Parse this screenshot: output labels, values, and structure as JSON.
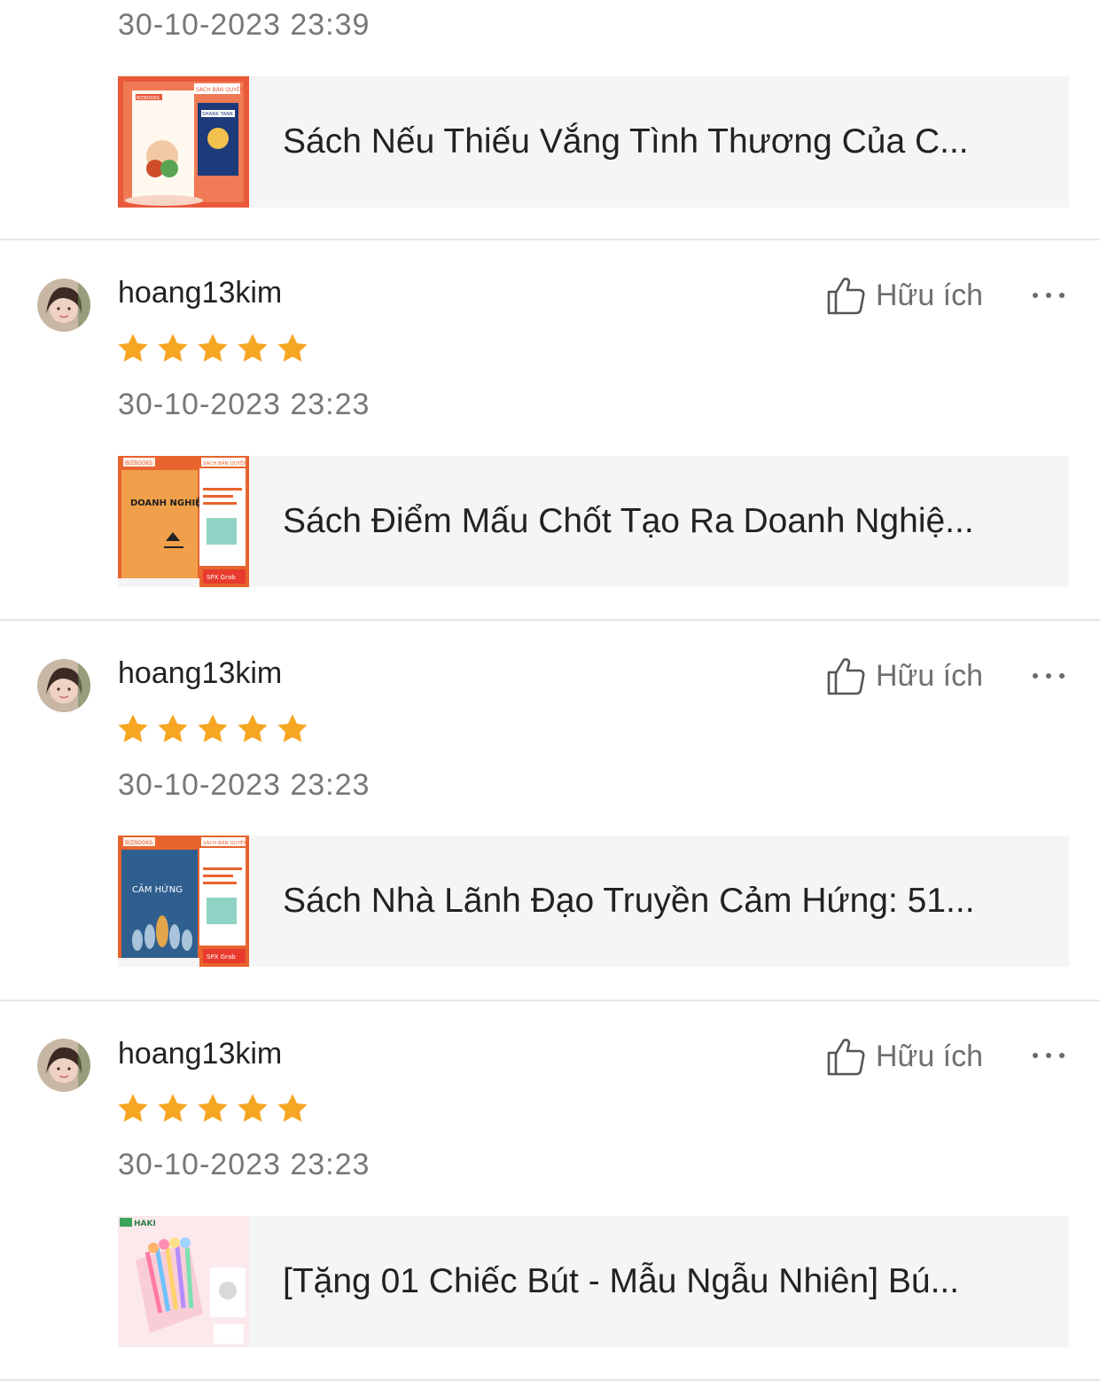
{
  "top_review": {
    "timestamp": "30-10-2023 23:39",
    "product": {
      "title": "Sách Nếu Thiếu Vắng Tình Thương Của C...",
      "thumb_badge": "BIZBOOKS",
      "thumb_tag": "SÁCH BẢN QUYỀN",
      "thumb_side": "SHARK TANK"
    }
  },
  "reviews": [
    {
      "username": "hoang13kim",
      "helpful_label": "Hữu ích",
      "rating": 5,
      "timestamp": "30-10-2023 23:23",
      "product": {
        "title": "Sách Điểm Mấu Chốt Tạo Ra Doanh Nghiệ...",
        "thumb_badge": "BIZBOOKS",
        "thumb_tag": "SÁCH BẢN QUYỀN",
        "thumb_title": "DOANH NGHIỆP",
        "thumb_footer": "SPX Grab"
      }
    },
    {
      "username": "hoang13kim",
      "helpful_label": "Hữu ích",
      "rating": 5,
      "timestamp": "30-10-2023 23:23",
      "product": {
        "title": "Sách Nhà Lãnh Đạo Truyền Cảm Hứng: 51...",
        "thumb_badge": "BIZBOOKS",
        "thumb_tag": "SÁCH BẢN QUYỀN",
        "thumb_title": "CẢM HỨNG",
        "thumb_footer": "SPX Grab"
      }
    },
    {
      "username": "hoang13kim",
      "helpful_label": "Hữu ích",
      "rating": 5,
      "timestamp": "30-10-2023 23:23",
      "product": {
        "title": "[Tặng  01 Chiếc Bút - Mẫu Ngẫu Nhiên] Bú...",
        "thumb_badge": "HAKI"
      }
    }
  ],
  "colors": {
    "star": "#f6a623",
    "card_bg": "#f5f5f5",
    "divider": "#e6e6e6",
    "muted_text": "#777777",
    "book_orange": "#e8642e"
  }
}
